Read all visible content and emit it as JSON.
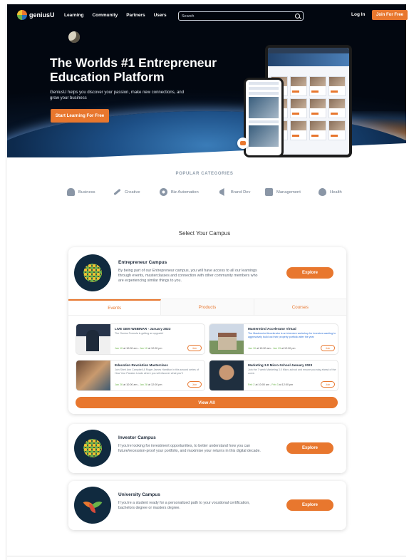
{
  "nav": {
    "brand": "geniusU",
    "links": [
      "Learning",
      "Community",
      "Partners",
      "Users"
    ],
    "search_placeholder": "Search",
    "login": "Log In",
    "join": "Join For Free"
  },
  "hero": {
    "title": "The Worlds #1 Entrepreneur Education Platform",
    "subtitle": "GeniusU helps you discover your passion, make new connections, and grow your business",
    "cta": "Start Learning For Free"
  },
  "categories": {
    "title": "POPULAR CATEGORIES",
    "items": [
      {
        "label": "Business",
        "icon": "briefcase-icon"
      },
      {
        "label": "Creative",
        "icon": "brush-icon"
      },
      {
        "label": "Biz Automation",
        "icon": "gear-icon"
      },
      {
        "label": "Brand Dev",
        "icon": "megaphone-icon"
      },
      {
        "label": "Management",
        "icon": "folder-icon"
      },
      {
        "label": "Health",
        "icon": "heart-icon"
      }
    ]
  },
  "campus_section": {
    "title": "Select Your Campus"
  },
  "campuses": [
    {
      "name": "Entrepreneur Campus",
      "description": "By being part of our Entrepreneur campus, you will have access to all our learnings through events, masterclasses and connection with other community members who are experiencing similar things to you.",
      "explore": "Explore",
      "tabs": [
        "Events",
        "Products",
        "Courses"
      ],
      "events": [
        {
          "title": "LIVE GEM WEBINAR - January 2023",
          "desc": "The Genius Formula is getting an upgrade!",
          "start": "Jan 10",
          "start_time": " at 10:00 am - ",
          "end": "Jan 10",
          "end_time": " at 12:00 pm",
          "join": "Join"
        },
        {
          "title": "Mastermind Accelerator Virtual",
          "desc": "The Mastermind Accelerator is an intensive workshop for investors wanting to aggressively build out their property portfolio after the year",
          "start": "Jan 10",
          "start_time": " at 10:00 am - ",
          "end": "Jan 13",
          "end_time": " at 12:00 pm",
          "join": "Join"
        },
        {
          "title": "Education Revolution Masterclass",
          "desc": "Join Sheri Ann Campbell & Roger James Hamilton in this second series of How Your Passion Leads where you will discover what you'll",
          "start": "Jan 26",
          "start_time": " at 10:00 am - ",
          "end": "Jan 28",
          "end_time": " at 12:00 pm",
          "join": "Join"
        },
        {
          "title": "Marketing 3.0 Micro-School January 2023",
          "desc": "Join the 7 week Marketing 3.0 Micro-school and ensure you stay ahead of the curve.",
          "start": "Feb 2",
          "start_time": " at 10:00 am - ",
          "end": "Feb 3",
          "end_time": " at 12:00 pm",
          "join": "Join"
        }
      ],
      "view_all": "View All"
    },
    {
      "name": "Investor Campus",
      "description": "If you're looking for investment opportunities, to better understand how you can future/recession-proof your portfolio, and maximise your returns in this digital decade.",
      "explore": "Explore"
    },
    {
      "name": "University Campus",
      "description": "If you're a student ready for a personalized path to your vocational certification, bachelors degree or masters degree.",
      "explore": "Explore"
    }
  ],
  "colors": {
    "accent": "#e8772e",
    "dark": "#102a3f",
    "date_green": "#6bb34a"
  }
}
